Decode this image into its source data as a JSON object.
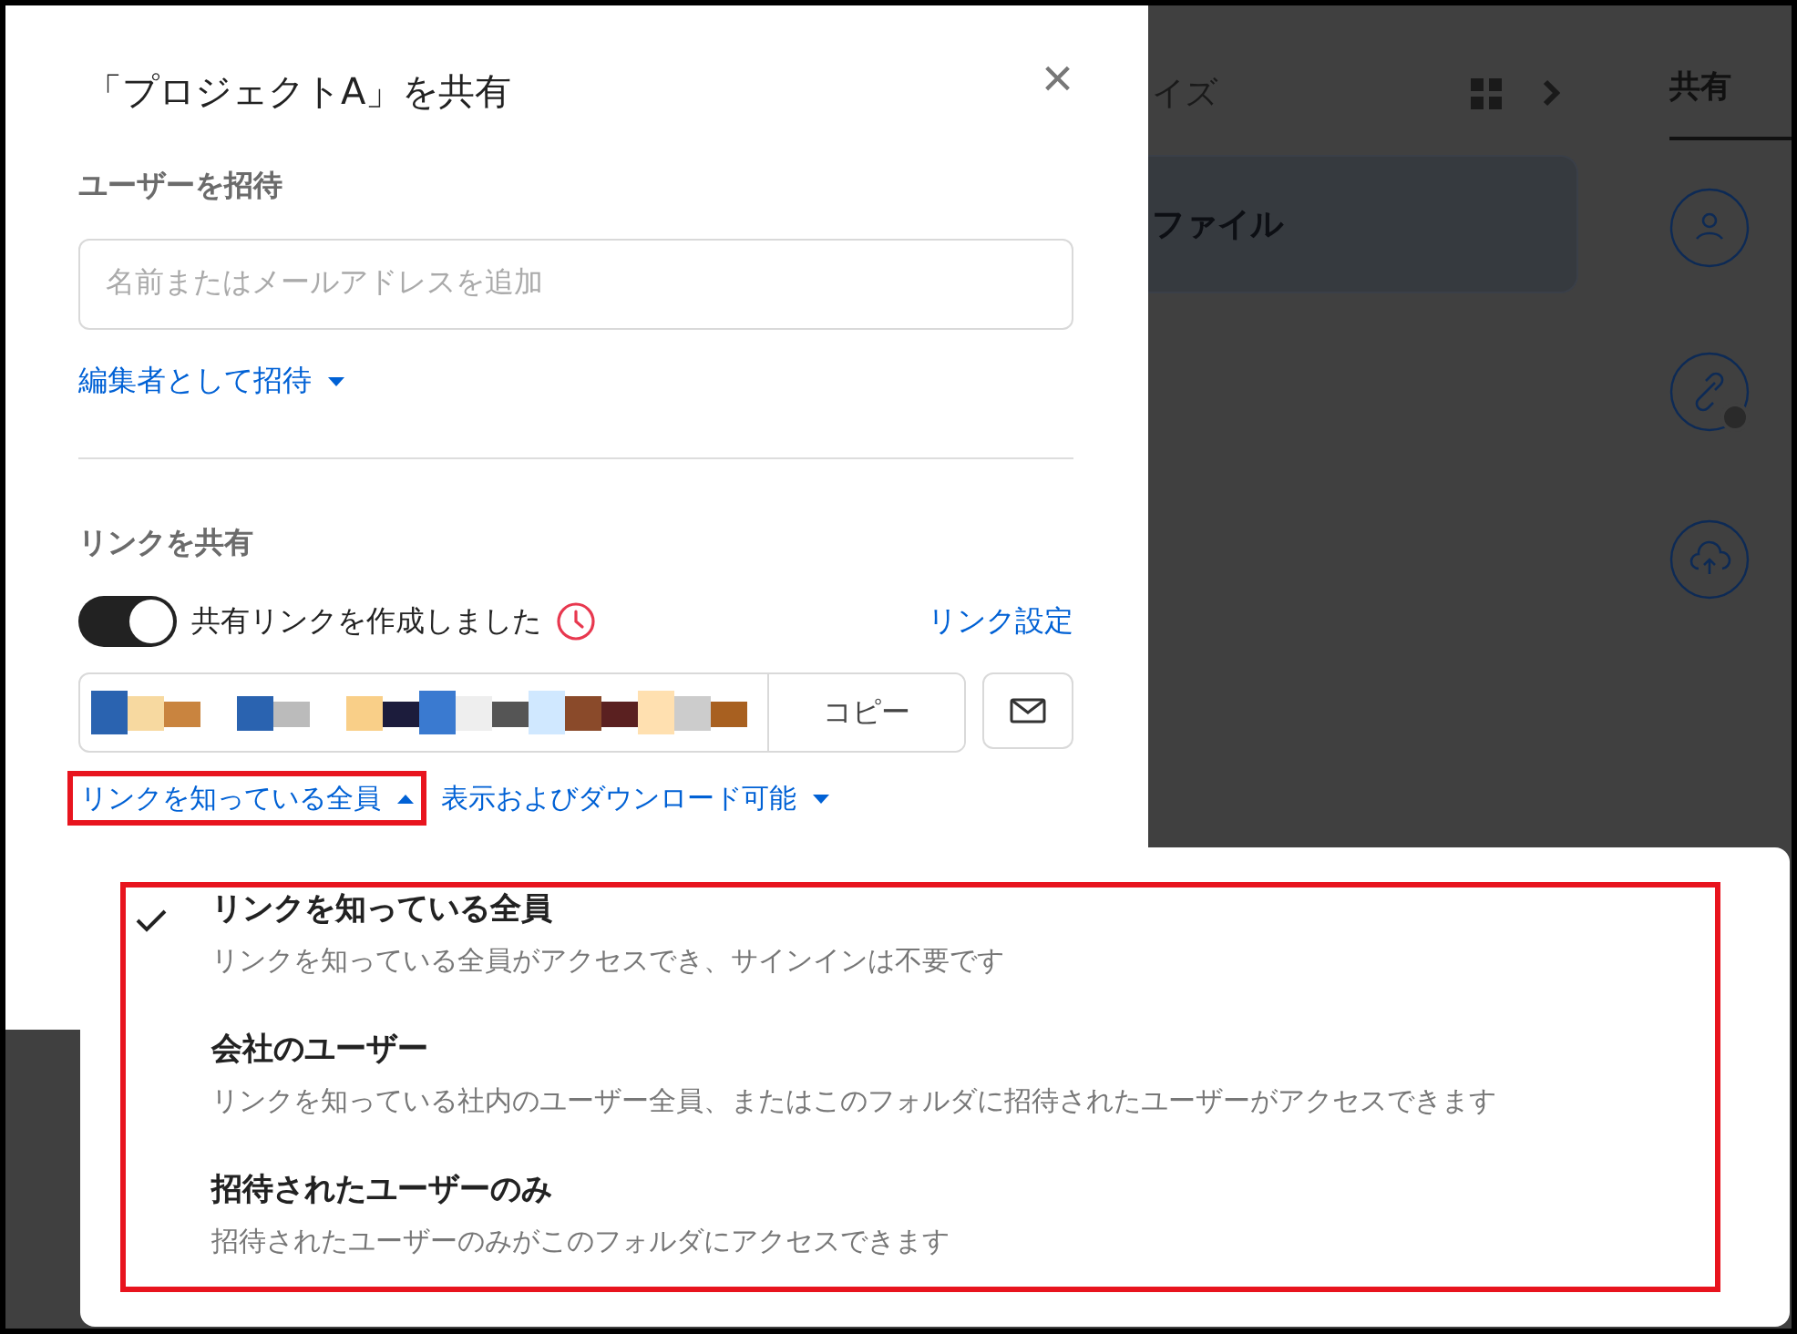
{
  "background": {
    "toolbar_text": "イズ",
    "file_card": "ファイル",
    "side_tab": "共有"
  },
  "dialog": {
    "title": "「プロジェクトA」を共有",
    "close": "×",
    "invite": {
      "heading": "ユーザーを招待",
      "placeholder": "名前またはメールアドレスを追加",
      "role": "編集者として招待"
    },
    "link": {
      "heading": "リンクを共有",
      "toggle_on": true,
      "status": "共有リンクを作成しました",
      "settings": "リンク設定",
      "copy": "コピー",
      "access": "リンクを知っている全員",
      "permission": "表示およびダウンロード可能"
    }
  },
  "menu": {
    "items": [
      {
        "title": "リンクを知っている全員",
        "description": "リンクを知っている全員がアクセスでき、サインインは不要です",
        "selected": true
      },
      {
        "title": "会社のユーザー",
        "description": "リンクを知っている社内のユーザー全員、またはこのフォルダに招待されたユーザーがアクセスできます",
        "selected": false
      },
      {
        "title": "招待されたユーザーのみ",
        "description": "招待されたユーザーのみがこのフォルダにアクセスできます",
        "selected": false
      }
    ]
  }
}
